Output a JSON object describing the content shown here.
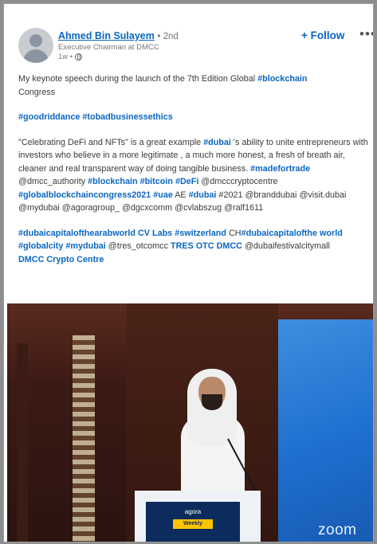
{
  "post": {
    "author_name": "Ahmed Bin Sulayem",
    "degree": "• 2nd",
    "author_title": "Executive Chairman at DMCC",
    "time": "1w •",
    "follow_label": "+ Follow",
    "more_label": "•••"
  },
  "body": {
    "line1": "My keynote speech during the launch of the 7th Edition Global ",
    "line1_tag": "#blockchain",
    "line1_end": "Congress",
    "tags2": "#goodriddance #tobadbusinessethics",
    "p3_a": "\"Celebrating DeFi and NFTs\" is a great example ",
    "p3_tag1": "#dubai",
    "p3_b": " 's ability to unite entrepreneurs with investors who believe in a more legitimate , a much more honest, a fresh of breath air, cleaner and real transparent way of doing tangible business. ",
    "p3_tag2": "#madefortrade",
    "p3_c": " @dmcc_authority ",
    "p3_tag3": "#blockchain",
    "p3_tag4": "#bitcoin",
    "p3_tag5": "#DeFi",
    "p3_d": " @dmcccryptocentre ",
    "p3_tag6": "#globalblockchaincongress2021",
    "p3_tag7": "#uae",
    "p3_e": " AE ",
    "p3_tag8": "#dubai",
    "p3_f": " #2021 @branddubai @visit.dubai @mydubai @agoragroup_ @dgcxcomm @cvlabszug @ralf1611",
    "p4_tag1": "#dubaicapitalofthearabworld",
    "p4_a": " CV Labs ",
    "p4_tag2": "#switzerland",
    "p4_b": " CH",
    "p4_tag3": "#dubaicapitalofthe world",
    "p4_tag4": "#globalcity",
    "p4_tag5": "#mydubai",
    "p4_c": " @tres_otcomcc ",
    "p4_tag6": "TRES OTC DMCC",
    "p4_d": " @dubaifestivalcitymall ",
    "p4_tag7": "DMCC Crypto Centre"
  },
  "video": {
    "podium_logo": "agora",
    "podium_chip": "Weekly",
    "watermark": "zoom"
  },
  "colors": {
    "link": "#0a66c2",
    "screen": "#1f6fd0"
  }
}
